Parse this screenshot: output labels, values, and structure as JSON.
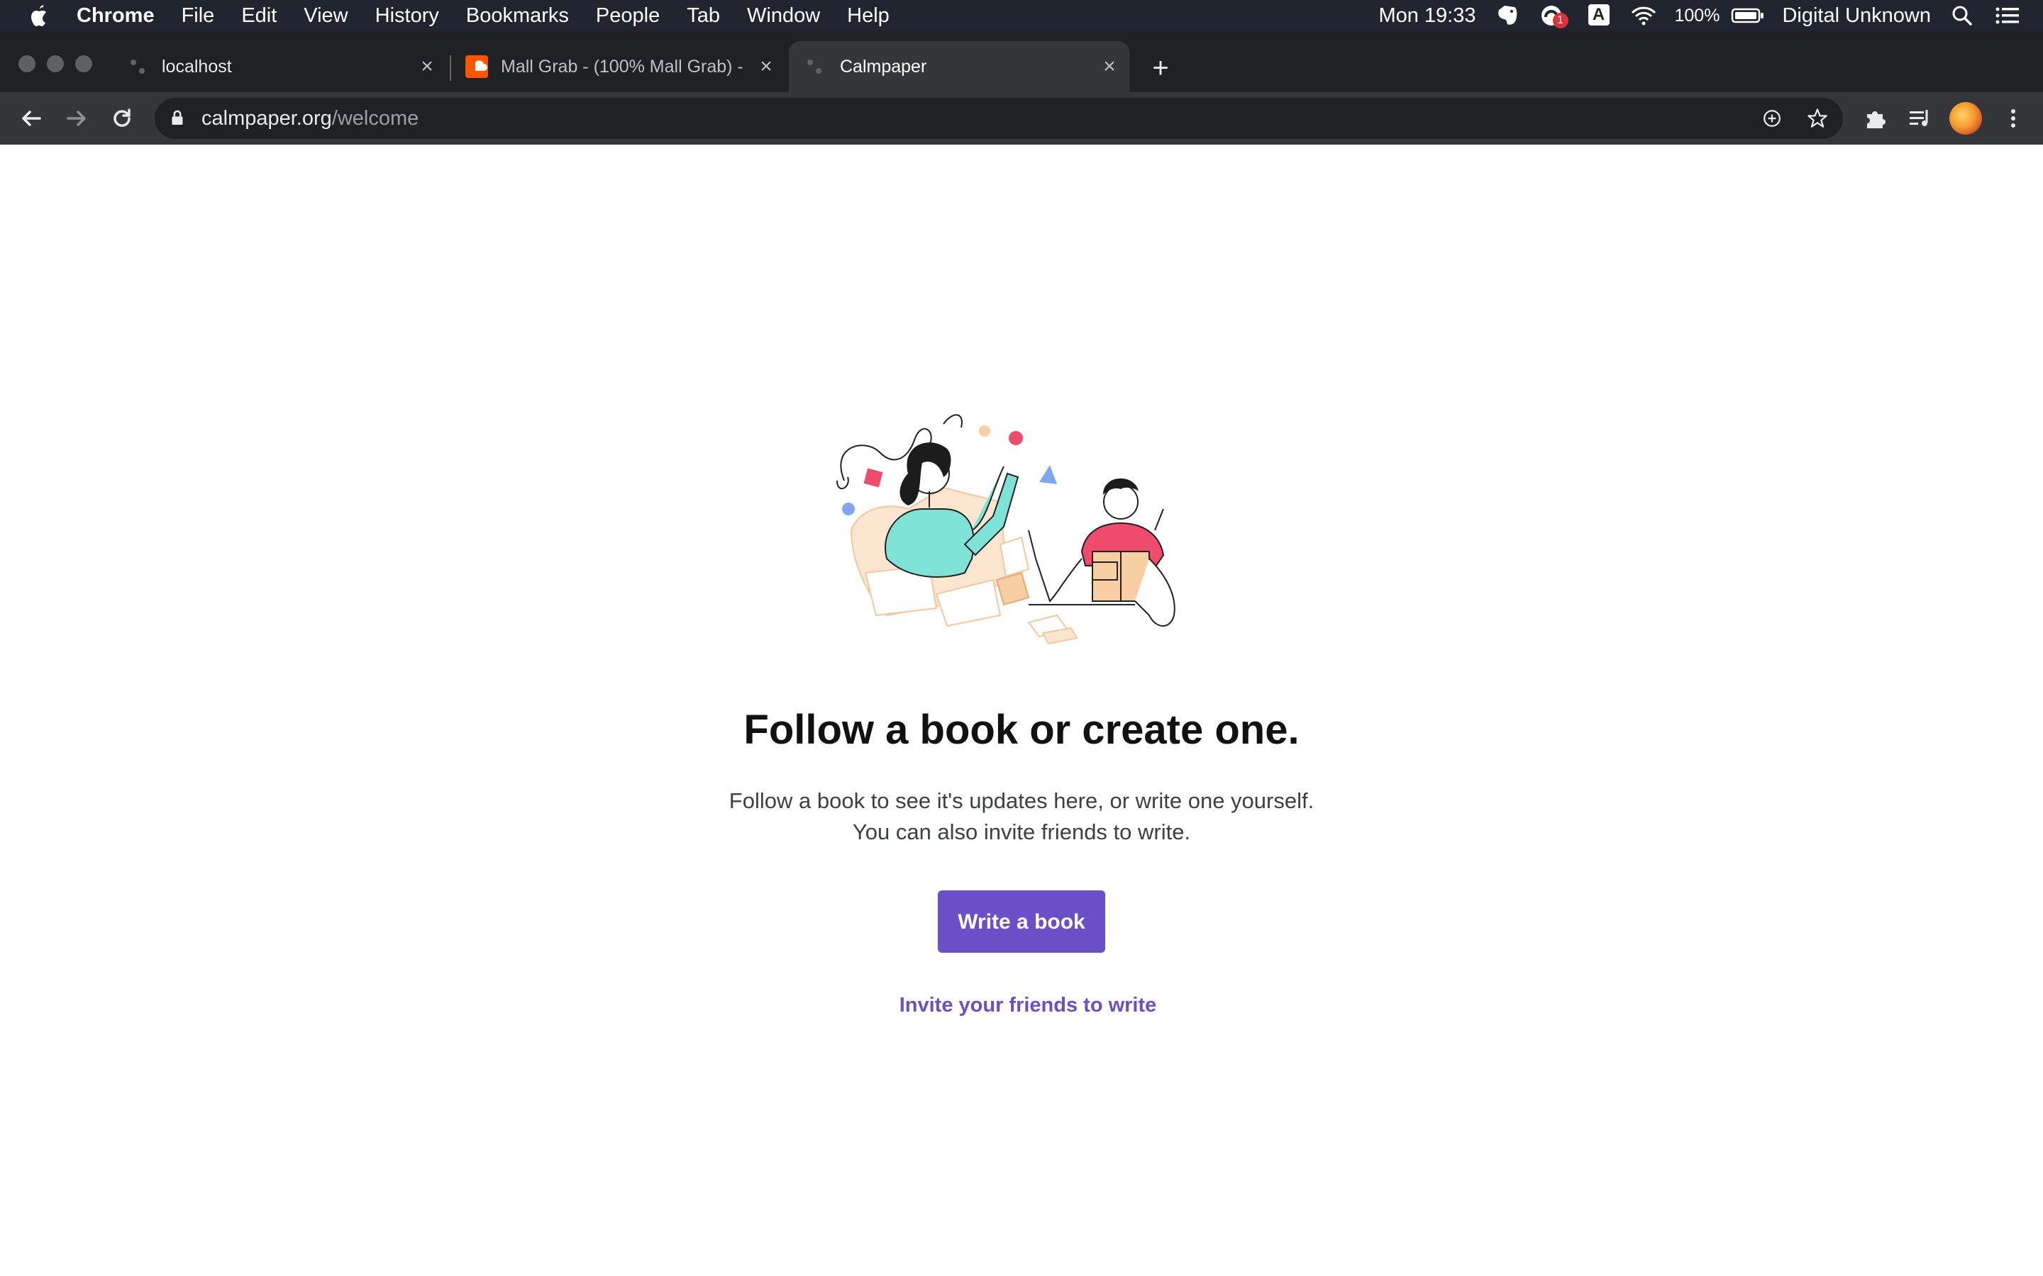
{
  "menubar": {
    "app_name": "Chrome",
    "items": [
      "File",
      "Edit",
      "View",
      "History",
      "Bookmarks",
      "People",
      "Tab",
      "Window",
      "Help"
    ],
    "clock": "Mon 19:33",
    "battery_percent": "100%",
    "user_name": "Digital Unknown",
    "notification_count": "1",
    "input_source": "A",
    "icons": [
      "apple-logo-icon",
      "evernote-icon",
      "notification-icon",
      "input-source-icon",
      "wifi-icon",
      "battery-icon",
      "spotlight-search-icon",
      "control-center-list-icon"
    ]
  },
  "tabs": [
    {
      "title": "localhost",
      "favicon": "loading-dots-icon",
      "active": false
    },
    {
      "title": "Mall Grab - (100% Mall Grab) -",
      "favicon": "soundcloud-icon",
      "active": false
    },
    {
      "title": "Calmpaper",
      "favicon": "loading-dots-icon",
      "active": true
    }
  ],
  "toolbar": {
    "url_host": "calmpaper.org",
    "url_path": "/welcome",
    "icons": [
      "back-arrow-icon",
      "forward-arrow-icon",
      "reload-icon",
      "lock-icon",
      "install-app-icon",
      "bookmark-star-icon",
      "extensions-puzzle-icon",
      "media-queue-icon",
      "profile-avatar",
      "more-vertical-icon"
    ]
  },
  "page": {
    "heading": "Follow a book or create one.",
    "subtitle_line1": "Follow a book to see it's updates here, or write one yourself.",
    "subtitle_line2": "You can also invite friends to write.",
    "primary_button": "Write a book",
    "invite_link": "Invite your friends to write"
  },
  "colors": {
    "accent": "#6a4fc8",
    "menubar_bg": "#20252f",
    "tabstrip_bg": "#202124",
    "toolbar_bg": "#35363a",
    "notification_badge": "#e0303a"
  }
}
